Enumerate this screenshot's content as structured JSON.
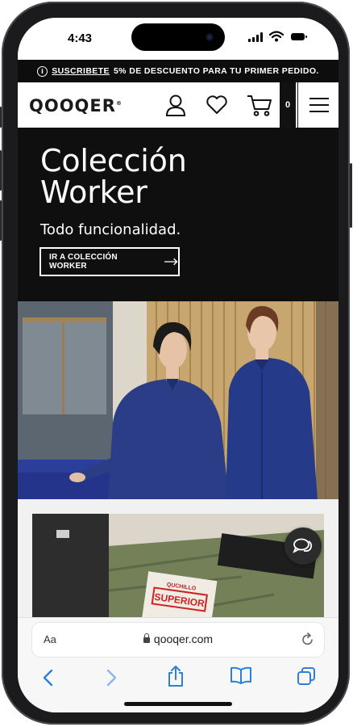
{
  "status_bar": {
    "time": "4:43"
  },
  "promo": {
    "link": "SUSCRIBETE",
    "text": "5% DE DESCUENTO PARA TU PRIMER PEDIDO."
  },
  "header": {
    "logo": "QOOQER",
    "logo_mark": "®",
    "cart_count": "0"
  },
  "hero": {
    "title_line1": "Colección",
    "title_line2": "Worker",
    "subtitle": "Todo funcionalidad.",
    "cta_label": "IR A COLECCIÓN WORKER"
  },
  "product_tag": {
    "line1": "QUCHILLO",
    "line2": "SUPERIOR"
  },
  "browser": {
    "text_size": "Aa",
    "domain": "qooqer.com"
  },
  "colors": {
    "hero_bg": "#0f0f0f",
    "accent_blue": "#2f7fd8",
    "jacket_blue": "#233a7a"
  },
  "icons": [
    "user-icon",
    "heart-icon",
    "cart-icon",
    "menu-icon",
    "chat-icon",
    "lock-icon",
    "reload-icon",
    "back-icon",
    "forward-icon",
    "share-icon",
    "bookmarks-icon",
    "tabs-icon"
  ]
}
